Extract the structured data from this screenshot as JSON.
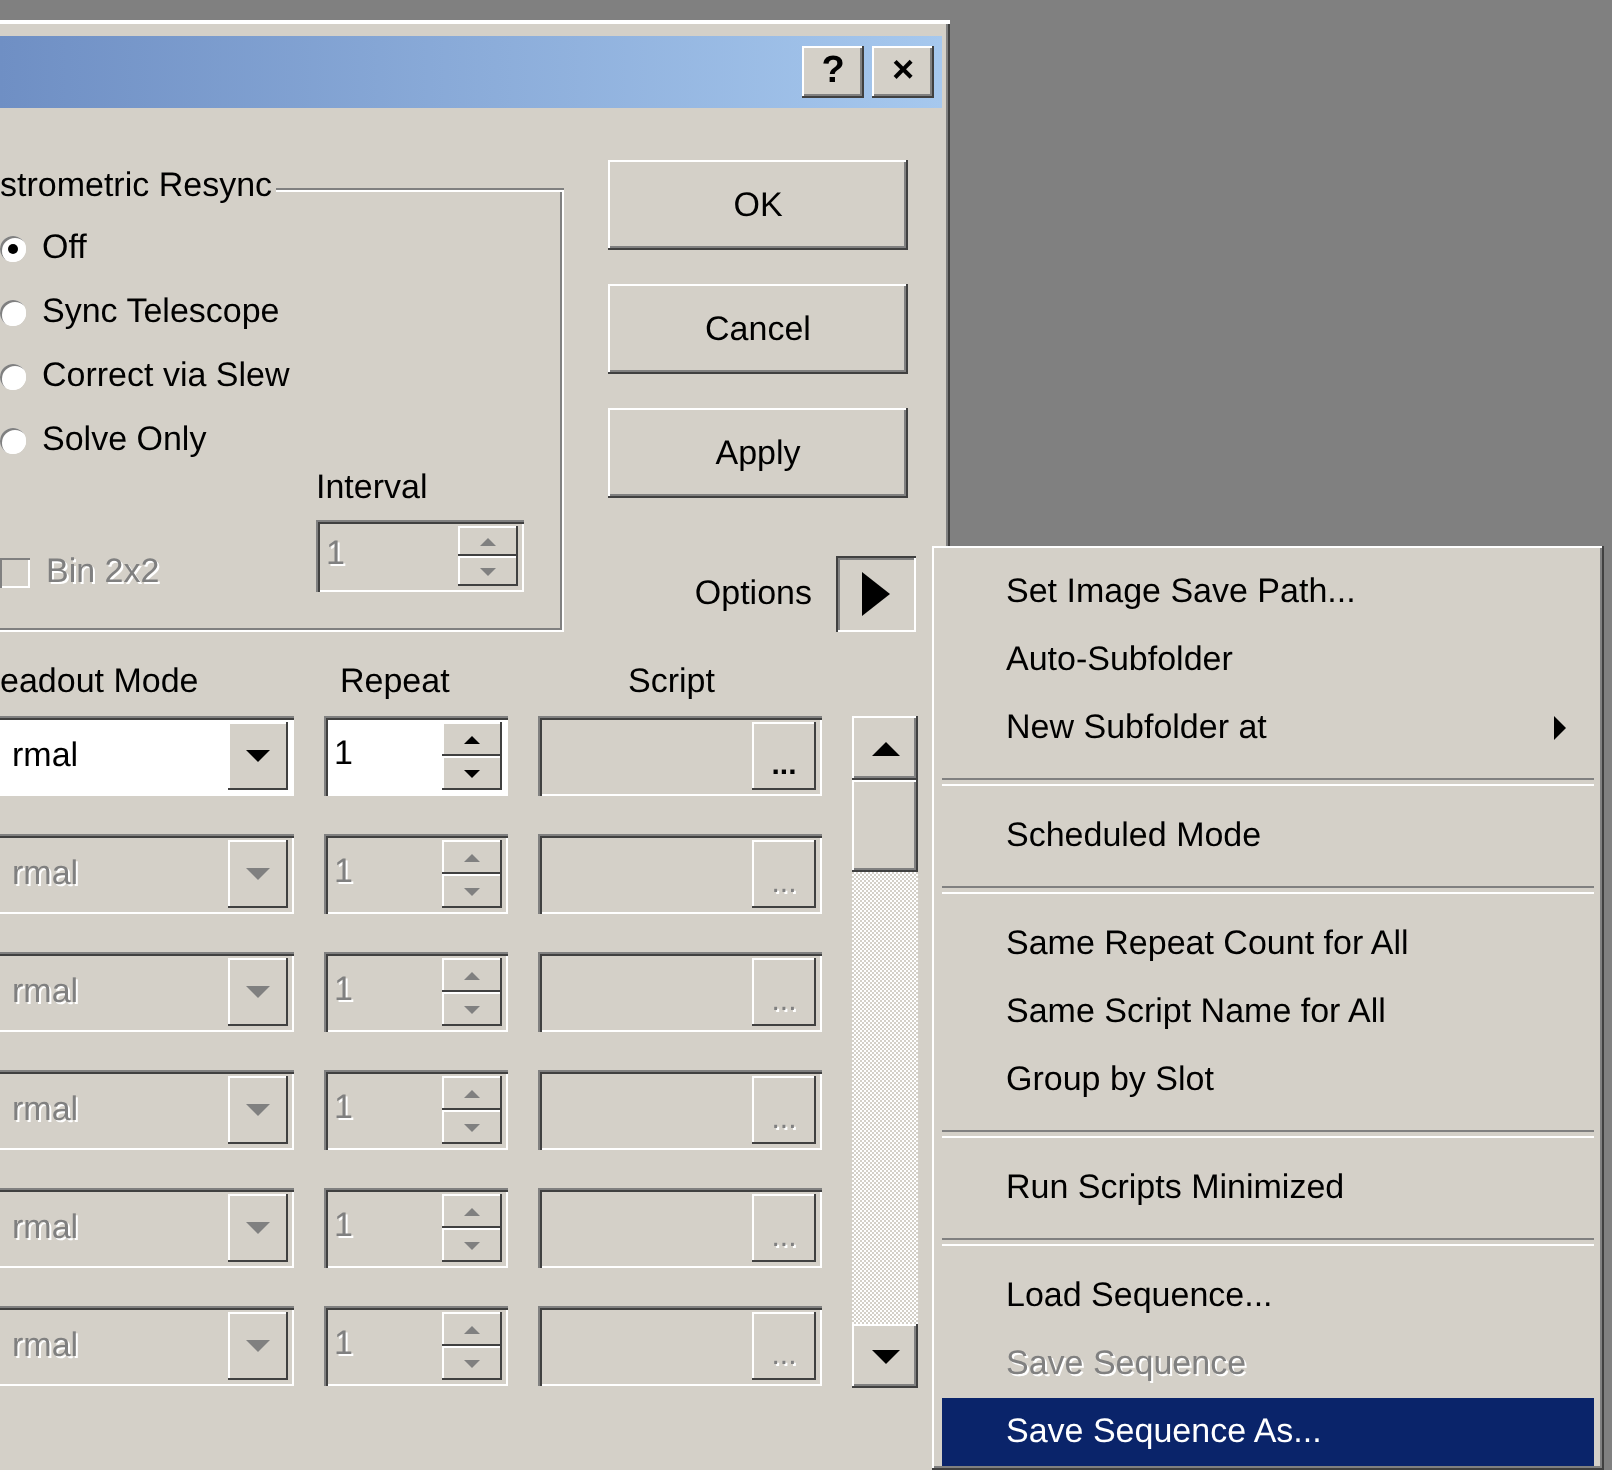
{
  "window": {
    "title_buttons": [
      "?",
      "×"
    ]
  },
  "resync_group": {
    "label": "strometric Resync",
    "options": [
      {
        "label": "Off",
        "selected": true
      },
      {
        "label": "Sync Telescope",
        "selected": false
      },
      {
        "label": "Correct via Slew",
        "selected": false
      },
      {
        "label": "Solve Only",
        "selected": false
      }
    ]
  },
  "bin": {
    "label": "Bin 2x2",
    "checked": false,
    "disabled": true
  },
  "interval": {
    "label": "Interval",
    "value": "1",
    "disabled": true
  },
  "buttons": [
    "OK",
    "Cancel",
    "Apply"
  ],
  "options": {
    "label": "Options"
  },
  "columns": [
    "eadout Mode",
    "Repeat",
    "Script"
  ],
  "rows": [
    {
      "mode": "rmal",
      "repeat": "1",
      "browse": "...",
      "disabled": false
    },
    {
      "mode": "rmal",
      "repeat": "1",
      "browse": "...",
      "disabled": true
    },
    {
      "mode": "rmal",
      "repeat": "1",
      "browse": "...",
      "disabled": true
    },
    {
      "mode": "rmal",
      "repeat": "1",
      "browse": "...",
      "disabled": true
    },
    {
      "mode": "rmal",
      "repeat": "1",
      "browse": "...",
      "disabled": true
    },
    {
      "mode": "rmal",
      "repeat": "1",
      "browse": "...",
      "disabled": true
    }
  ],
  "menu": {
    "items": [
      {
        "kind": "item",
        "label": "Set Image Save Path...",
        "disabled": false,
        "selected": false,
        "submenu": false
      },
      {
        "kind": "item",
        "label": "Auto-Subfolder",
        "disabled": false,
        "selected": false,
        "submenu": false
      },
      {
        "kind": "item",
        "label": "New Subfolder at",
        "disabled": false,
        "selected": false,
        "submenu": true
      },
      {
        "kind": "separator"
      },
      {
        "kind": "item",
        "label": "Scheduled Mode",
        "disabled": false,
        "selected": false,
        "submenu": false
      },
      {
        "kind": "separator"
      },
      {
        "kind": "item",
        "label": "Same Repeat Count for All",
        "disabled": false,
        "selected": false,
        "submenu": false
      },
      {
        "kind": "item",
        "label": "Same Script Name for All",
        "disabled": false,
        "selected": false,
        "submenu": false
      },
      {
        "kind": "item",
        "label": "Group by Slot",
        "disabled": false,
        "selected": false,
        "submenu": false
      },
      {
        "kind": "separator"
      },
      {
        "kind": "item",
        "label": "Run Scripts Minimized",
        "disabled": false,
        "selected": false,
        "submenu": false
      },
      {
        "kind": "separator"
      },
      {
        "kind": "item",
        "label": "Load Sequence...",
        "disabled": false,
        "selected": false,
        "submenu": false
      },
      {
        "kind": "item",
        "label": "Save Sequence",
        "disabled": true,
        "selected": false,
        "submenu": false
      },
      {
        "kind": "item",
        "label": "Save Sequence As...",
        "disabled": false,
        "selected": true,
        "submenu": false
      }
    ]
  }
}
